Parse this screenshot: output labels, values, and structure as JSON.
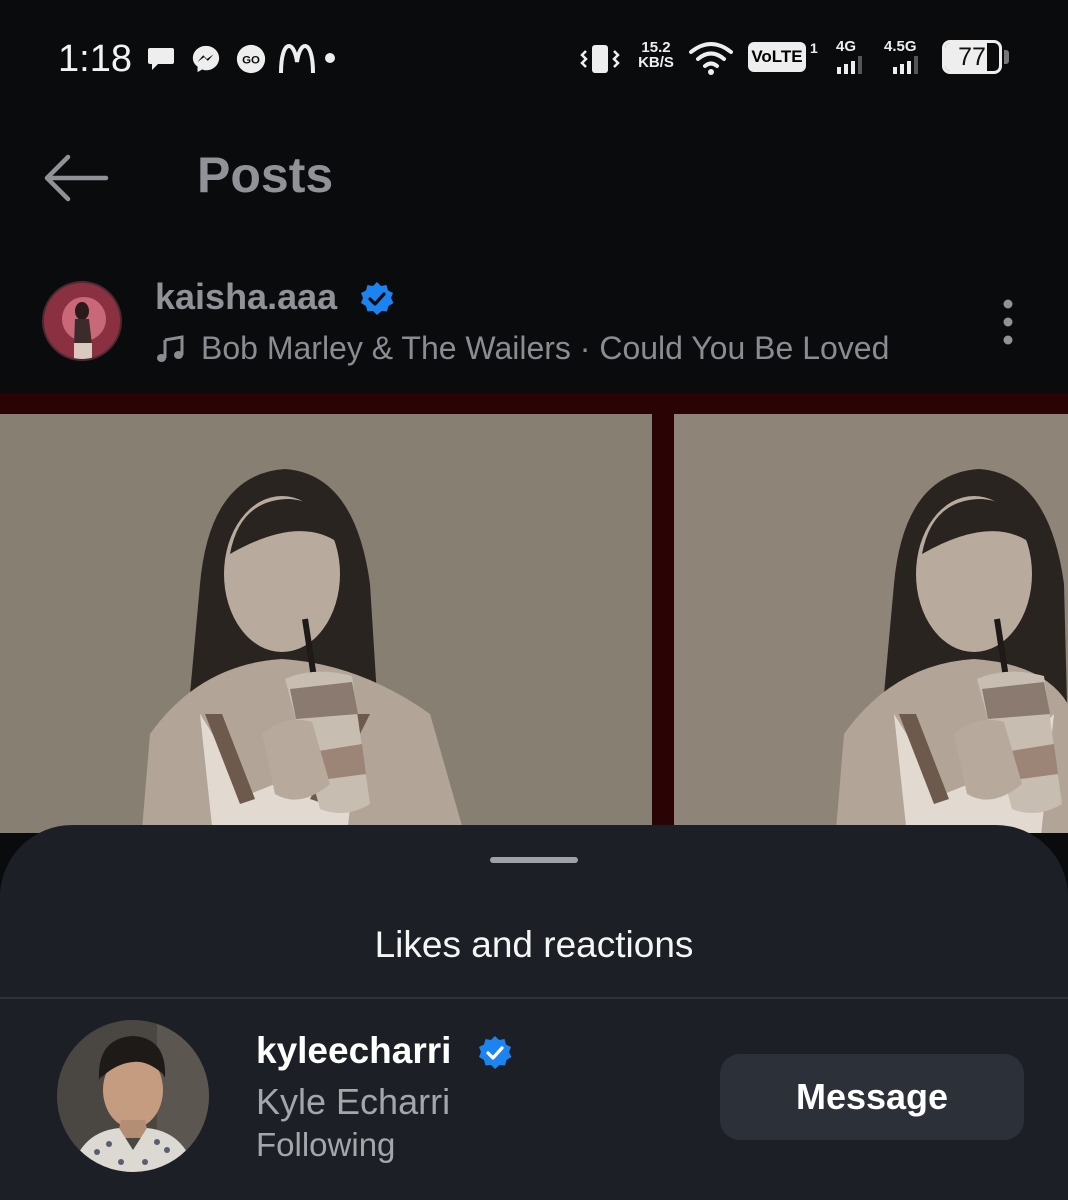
{
  "status_bar": {
    "time": "1:18",
    "net_speed_value": "15.2",
    "net_speed_unit": "KB/S",
    "volte": "VoLTE",
    "sim_slot": "1",
    "network_1": "4G",
    "network_2": "4.5G",
    "battery_level": 77,
    "battery_text": "77",
    "notification_icons": [
      "chat-bubble-icon",
      "messenger-icon",
      "go-icon",
      "mcdonalds-icon"
    ]
  },
  "header": {
    "title": "Posts"
  },
  "post": {
    "username": "kaisha.aaa",
    "verified": true,
    "music": "Bob Marley & The Wailers · Could You Be Loved"
  },
  "sheet": {
    "title": "Likes and reactions",
    "user": {
      "username": "kyleecharri",
      "verified": true,
      "full_name": "Kyle Echarri",
      "status": "Following",
      "button_label": "Message"
    }
  },
  "colors": {
    "background": "#0a0b0d",
    "sheet": "#1c2026",
    "verified_blue": "#1d83f0",
    "button": "#2c3038",
    "photo_frame": "#2a0405"
  }
}
